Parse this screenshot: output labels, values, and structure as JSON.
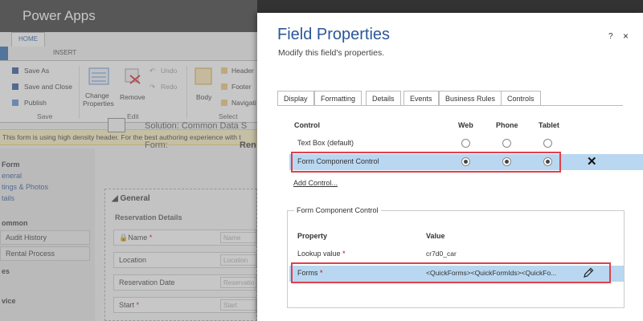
{
  "app": {
    "title": "Power Apps"
  },
  "ribbon": {
    "tabs": [
      "HOME",
      "INSERT"
    ],
    "save_as": "Save As",
    "save_close": "Save and Close",
    "publish": "Publish",
    "save_group": "Save",
    "change_props_1": "Change",
    "change_props_2": "Properties",
    "remove": "Remove",
    "undo": "Undo",
    "redo": "Redo",
    "edit_group": "Edit",
    "body": "Body",
    "header": "Header",
    "footer": "Footer",
    "navigation": "Navigati",
    "select_group": "Select"
  },
  "banner": "This form is using high density header. For the best authoring experience with t",
  "leftnav": {
    "form": "Form",
    "general": "eneral",
    "ratings": "tings & Photos",
    "details": "tails",
    "common": "ommon",
    "audit": "Audit History",
    "rental": "Rental Process",
    "es": "es",
    "vice": "vice"
  },
  "formheader": {
    "solution": "Solution: Common Data S",
    "form_label": "Form:",
    "form_value": "Ren"
  },
  "form": {
    "section": "General",
    "subsection": "Reservation Details",
    "rows": [
      {
        "label": "Name",
        "required": "*",
        "placeholder": "Name"
      },
      {
        "label": "Location",
        "required": "",
        "placeholder": "Location"
      },
      {
        "label": "Reservation Date",
        "required": "",
        "placeholder": "Reservatio"
      },
      {
        "label": "Start",
        "required": "*",
        "placeholder": "Start"
      }
    ]
  },
  "dialog": {
    "title": "Field Properties",
    "subtitle": "Modify this field's properties.",
    "help": "?",
    "close": "×",
    "tabs": [
      "Display",
      "Formatting",
      "Details",
      "Events",
      "Business Rules",
      "Controls"
    ],
    "active_tab": "Controls",
    "controls": {
      "headers": {
        "control": "Control",
        "web": "Web",
        "phone": "Phone",
        "tablet": "Tablet"
      },
      "rows": [
        {
          "name": "Text Box (default)",
          "web": false,
          "phone": false,
          "tablet": false
        },
        {
          "name": "Form Component Control",
          "web": true,
          "phone": true,
          "tablet": true
        }
      ],
      "add_control": "Add Control..."
    },
    "component": {
      "legend": "Form Component Control",
      "headers": {
        "property": "Property",
        "value": "Value"
      },
      "rows": [
        {
          "property": "Lookup value",
          "required": "*",
          "value": "cr7d0_car"
        },
        {
          "property": "Forms",
          "required": "*",
          "value": "<QuickForms><QuickFormIds><QuickFo..."
        }
      ]
    }
  },
  "colors": {
    "accent": "#2b5797",
    "highlight_border": "#e0404a",
    "selected_row": "#b9d7f0",
    "banner": "#fcf0c2"
  }
}
